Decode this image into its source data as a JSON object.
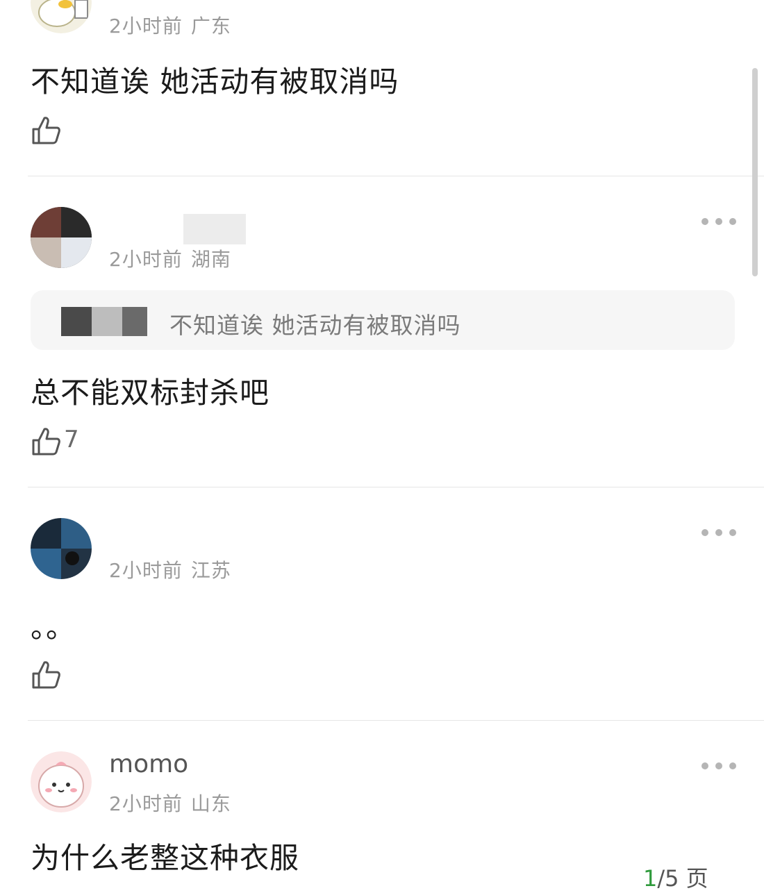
{
  "comments": [
    {
      "time": "2小时前",
      "location": "广东",
      "text": "不知道诶 她活动有被取消吗",
      "likes": ""
    },
    {
      "time": "2小时前",
      "location": "湖南",
      "quote": "不知道诶 她活动有被取消吗",
      "text": "总不能双标封杀吧",
      "likes": "7"
    },
    {
      "time": "2小时前",
      "location": "江苏",
      "text": "。。",
      "likes": ""
    },
    {
      "username": "momo",
      "time": "2小时前",
      "location": "山东",
      "text": "为什么老整这种衣服",
      "likes": ""
    }
  ],
  "pager": {
    "current": "1",
    "suffix": "/5 页"
  },
  "icons": {
    "like": "thumbs-up-icon",
    "more": "more-dots-icon"
  }
}
